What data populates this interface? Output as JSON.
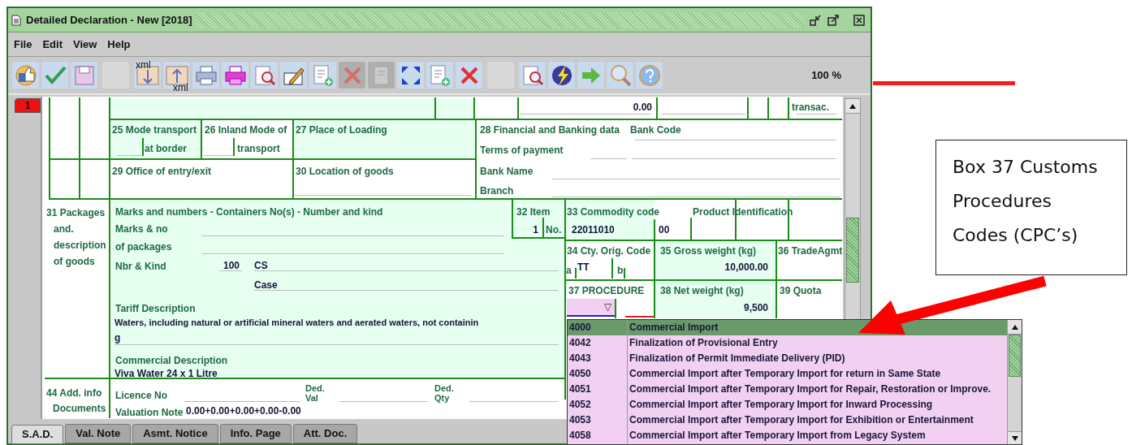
{
  "window": {
    "title": "Detailed Declaration - New [2018]"
  },
  "menu": [
    {
      "label": "File"
    },
    {
      "label": "Edit"
    },
    {
      "label": "View"
    },
    {
      "label": "Help"
    }
  ],
  "toolbar": {
    "zoom": "100 %",
    "buttons": [
      {
        "kind": "approve",
        "disabled": false
      },
      {
        "kind": "check",
        "disabled": false
      },
      {
        "kind": "save",
        "disabled": false
      },
      {
        "kind": "blank"
      },
      {
        "kind": "xml-import",
        "text": "xml",
        "disabled": false
      },
      {
        "kind": "xml-export",
        "text": "xml",
        "disabled": false
      },
      {
        "kind": "print",
        "disabled": false
      },
      {
        "kind": "print-color",
        "disabled": false
      },
      {
        "kind": "preview",
        "disabled": false
      },
      {
        "kind": "edit",
        "disabled": false
      },
      {
        "kind": "add-document",
        "disabled": false
      },
      {
        "kind": "delete",
        "disabled": true
      },
      {
        "kind": "remove-document",
        "disabled": true
      },
      {
        "kind": "expand",
        "disabled": false
      },
      {
        "kind": "add-document",
        "disabled": false
      },
      {
        "kind": "delete",
        "disabled": false
      },
      {
        "kind": "blank"
      },
      {
        "kind": "preview",
        "disabled": false
      },
      {
        "kind": "lightning",
        "disabled": false
      },
      {
        "kind": "forward",
        "disabled": false
      },
      {
        "kind": "search",
        "disabled": false
      },
      {
        "kind": "help",
        "disabled": false
      }
    ]
  },
  "record_tab": {
    "label": "1"
  },
  "cells": [
    {
      "kind": "value",
      "text": "0.00"
    },
    {
      "kind": "label",
      "text": "transac."
    },
    {
      "kind": "label",
      "text": "25 Mode transport"
    },
    {
      "kind": "label",
      "text": "at border"
    },
    {
      "kind": "label",
      "text": "26 Inland Mode of"
    },
    {
      "kind": "label",
      "text": "transport"
    },
    {
      "kind": "label",
      "text": "27 Place of Loading"
    },
    {
      "kind": "label",
      "text": "28 Financial and Banking data"
    },
    {
      "kind": "label",
      "text": "Bank Code"
    },
    {
      "kind": "label",
      "text": "Terms of payment"
    },
    {
      "kind": "label",
      "text": "29 Office of entry/exit"
    },
    {
      "kind": "label",
      "text": "30 Location of goods"
    },
    {
      "kind": "label",
      "text": "Bank Name"
    },
    {
      "kind": "label",
      "text": "Branch"
    },
    {
      "kind": "label",
      "text": "31 Packages"
    },
    {
      "kind": "label",
      "text": "and."
    },
    {
      "kind": "label",
      "text": "description"
    },
    {
      "kind": "label",
      "text": "of goods"
    },
    {
      "kind": "label",
      "text": "Marks and numbers - Containers No(s) - Number and kind"
    },
    {
      "kind": "label",
      "text": "Marks & no"
    },
    {
      "kind": "label",
      "text": "of packages"
    },
    {
      "kind": "label",
      "text": "Nbr & Kind"
    },
    {
      "kind": "value",
      "text": "100"
    },
    {
      "kind": "value",
      "text": "CS"
    },
    {
      "kind": "value",
      "text": "Case"
    },
    {
      "kind": "label",
      "text": "Tariff Description"
    },
    {
      "kind": "value",
      "text": "Waters, including natural or artificial mineral waters and aerated waters, not containin"
    },
    {
      "kind": "value",
      "text": "g"
    },
    {
      "kind": "label",
      "text": "Commercial Description"
    },
    {
      "kind": "value",
      "text": "Viva Water 24 x 1 Litre"
    },
    {
      "kind": "label",
      "text": "44 Add. info"
    },
    {
      "kind": "label",
      "text": "Documents"
    },
    {
      "kind": "label",
      "text": "Licence No"
    },
    {
      "kind": "label",
      "text": "Ded."
    },
    {
      "kind": "label",
      "text": "Val"
    },
    {
      "kind": "label",
      "text": "Ded."
    },
    {
      "kind": "label",
      "text": "Qty"
    },
    {
      "kind": "label",
      "text": "Valuation Note"
    },
    {
      "kind": "value",
      "text": "0.00+0.00+0.00+0.00-0.00"
    },
    {
      "kind": "label",
      "text": "32 Item"
    },
    {
      "kind": "value",
      "text": "1"
    },
    {
      "kind": "label",
      "text": "No."
    },
    {
      "kind": "label",
      "text": "33 Commodity code"
    },
    {
      "kind": "value",
      "text": "22011010"
    },
    {
      "kind": "value",
      "text": "00"
    },
    {
      "kind": "label",
      "text": "Product Identification"
    },
    {
      "kind": "label",
      "text": "34 Cty. Orig. Code"
    },
    {
      "kind": "label",
      "text": "a"
    },
    {
      "kind": "value",
      "text": "TT"
    },
    {
      "kind": "label",
      "text": "b"
    },
    {
      "kind": "label",
      "text": "35 Gross weight (kg)"
    },
    {
      "kind": "value",
      "text": "10,000.00"
    },
    {
      "kind": "label",
      "text": "36 TradeAgmt"
    },
    {
      "kind": "label",
      "text": "37 PROCEDURE"
    },
    {
      "kind": "label",
      "text": "38 Net weight (kg)"
    },
    {
      "kind": "value",
      "text": "9,500"
    },
    {
      "kind": "label",
      "text": "39 Quota"
    }
  ],
  "procedure_field": {
    "arrow": "▽"
  },
  "procedure_options": [
    {
      "code": "4000",
      "description": "Commercial Import",
      "selected": true
    },
    {
      "code": "4042",
      "description": "Finalization of Provisional Entry",
      "selected": false
    },
    {
      "code": "4043",
      "description": "Finalization of Permit Immediate Delivery (PID)",
      "selected": false
    },
    {
      "code": "4050",
      "description": "Commercial Import after Temporary Import for return in Same State",
      "selected": false
    },
    {
      "code": "4051",
      "description": "Commercial Import after Temporary Import for Repair, Restoration or Improve.",
      "selected": false
    },
    {
      "code": "4052",
      "description": "Commercial Import after Temporary Import for Inward Processing",
      "selected": false
    },
    {
      "code": "4053",
      "description": "Commercial Import after Temporary Import  for Exhibition or Entertainment",
      "selected": false
    },
    {
      "code": "4058",
      "description": "Commercial Import after Temporary Import from Legacy System",
      "selected": false
    }
  ],
  "bottom_tabs": [
    {
      "label": "S.A.D.",
      "selected": true
    },
    {
      "label": "Val. Note",
      "selected": false
    },
    {
      "label": "Asmt. Notice",
      "selected": false
    },
    {
      "label": "Info. Page",
      "selected": false
    },
    {
      "label": "Att. Doc.",
      "selected": false
    }
  ],
  "callout": {
    "lines": [
      "Box 37 Customs",
      "Procedures",
      "Codes (CPC’s)"
    ]
  }
}
